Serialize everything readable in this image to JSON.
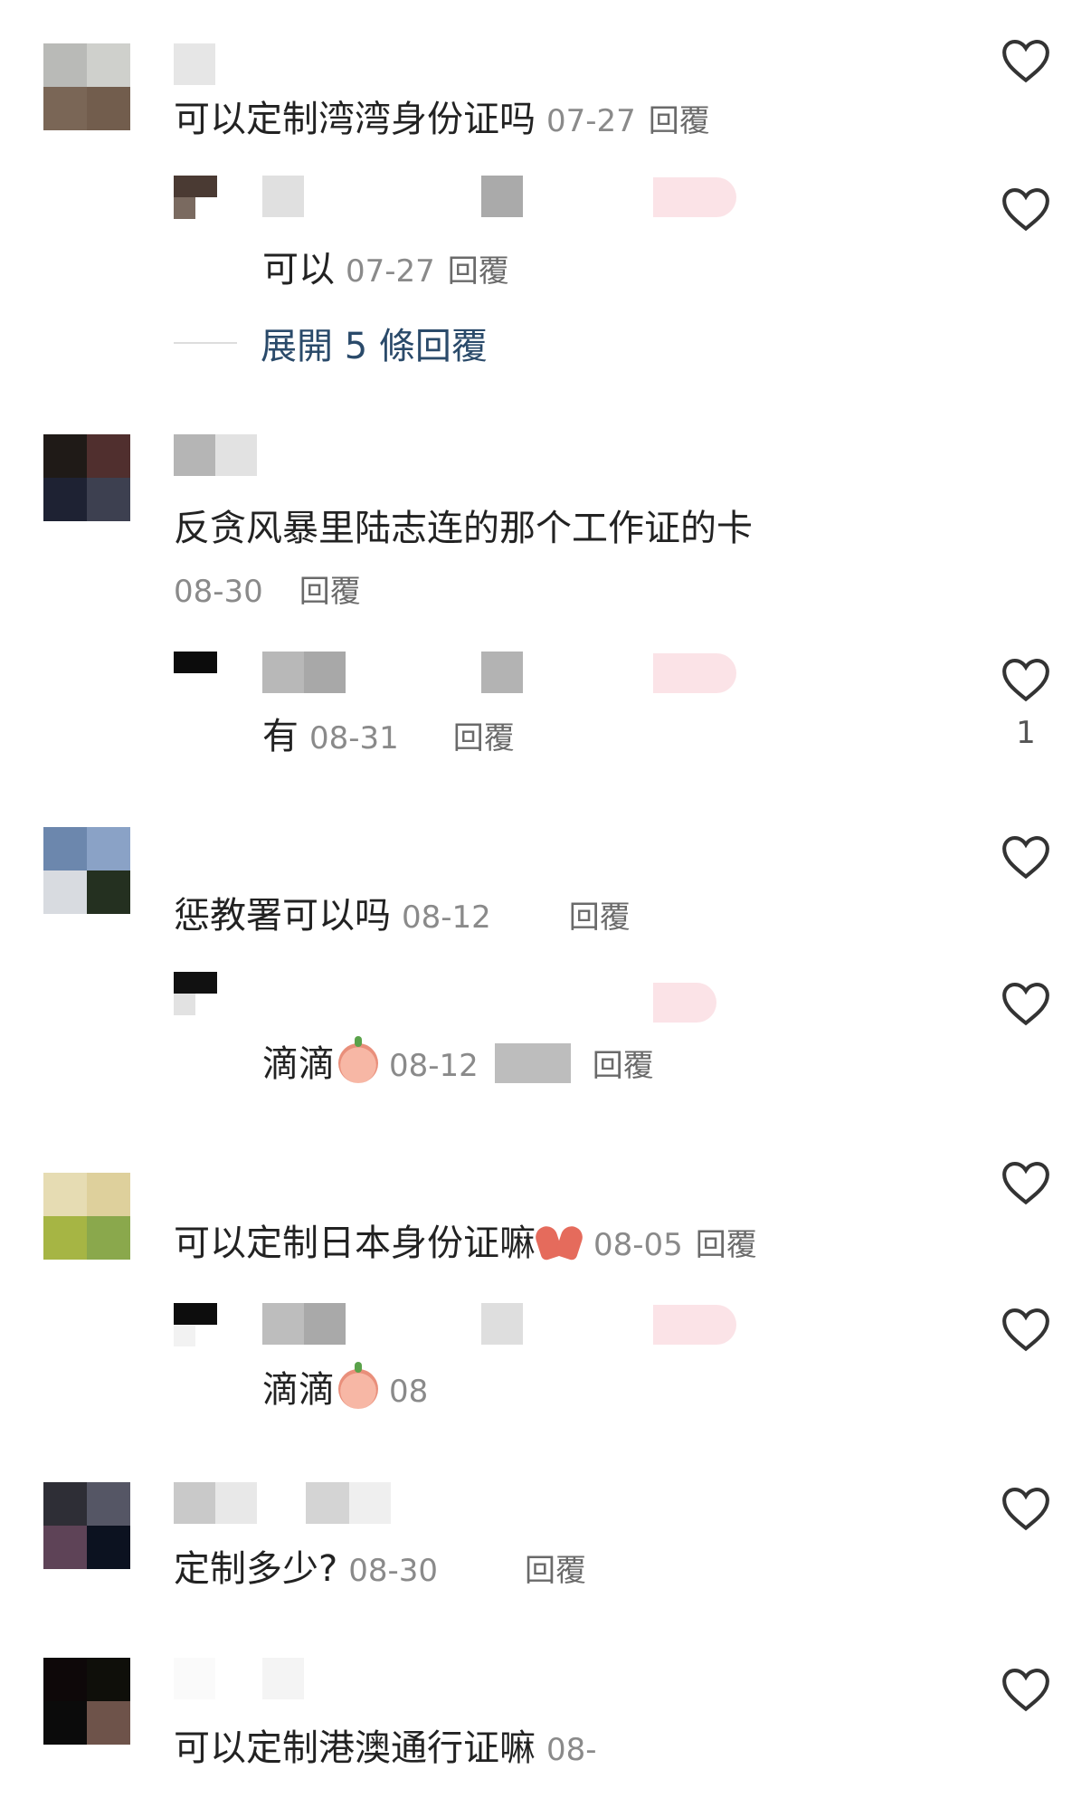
{
  "colors": {
    "accent_link": "#2a4a6a",
    "meta": "#8a8a8a",
    "heart_stroke": "#333333"
  },
  "icons": {
    "like": "heart-outline-icon"
  },
  "comments": [
    {
      "text": "可以定制湾湾身份证吗",
      "date": "07-27",
      "reply": "回覆"
    },
    {
      "text": "可以",
      "date": "07-27",
      "reply": "回覆"
    },
    {
      "expand": "展開 5 條回覆"
    },
    {
      "text": "反贪风暴里陆志连的那个工作证的卡",
      "date": "08-30",
      "reply": "回覆"
    },
    {
      "text": "有",
      "date": "08-31",
      "reply": "回覆",
      "likes": "1"
    },
    {
      "text": "惩教署可以吗",
      "date": "08-12",
      "reply": "回覆"
    },
    {
      "text": "滴滴",
      "date": "08-12",
      "reply": "回覆"
    },
    {
      "text": "可以定制日本身份证嘛",
      "date": "08-05",
      "reply": "回覆"
    },
    {
      "text": "滴滴",
      "date": "08"
    },
    {
      "text": "定制多少?",
      "date": "08-30",
      "reply": "回覆"
    },
    {
      "text": "可以定制港澳通行证嘛",
      "date": "08-"
    }
  ]
}
